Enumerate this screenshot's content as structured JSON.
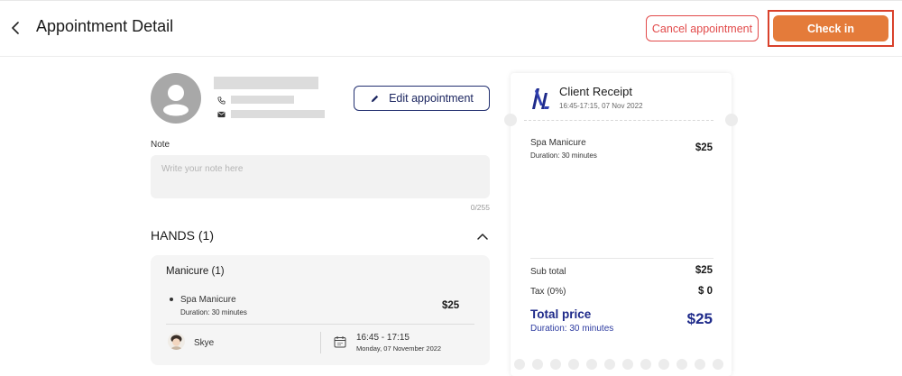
{
  "header": {
    "title": "Appointment Detail",
    "cancel_label": "Cancel appointment",
    "checkin_label": "Check in"
  },
  "client": {
    "edit_label": "Edit appointment"
  },
  "note": {
    "label": "Note",
    "placeholder": "Write your note here",
    "value": "",
    "counter": "0/255"
  },
  "section": {
    "title": "HANDS (1)",
    "category": "Manicure (1)",
    "service": {
      "name": "Spa Manicure",
      "duration": "Duration: 30 minutes",
      "price": "$25",
      "staff": "Skye",
      "time": "16:45 - 17:15",
      "date": "Monday, 07 November 2022"
    }
  },
  "receipt": {
    "title": "Client Receipt",
    "subtitle": "16:45-17:15, 07 Nov 2022",
    "item_name": "Spa Manicure",
    "item_duration": "Duration: 30 minutes",
    "item_price": "$25",
    "subtotal_label": "Sub total",
    "subtotal_value": "$25",
    "tax_label": "Tax (0%)",
    "tax_value": "$ 0",
    "total_label": "Total price",
    "total_duration": "Duration: 30 minutes",
    "total_value": "$25"
  },
  "colors": {
    "accent": "#e47b3a",
    "danger": "#e24a4a",
    "navy": "#1e2a8a"
  },
  "icons": [
    "back-arrow-icon",
    "user-avatar-icon",
    "phone-icon",
    "mail-icon",
    "pen-icon",
    "chevron-up-icon",
    "calendar-icon",
    "brand-logo-icon"
  ]
}
